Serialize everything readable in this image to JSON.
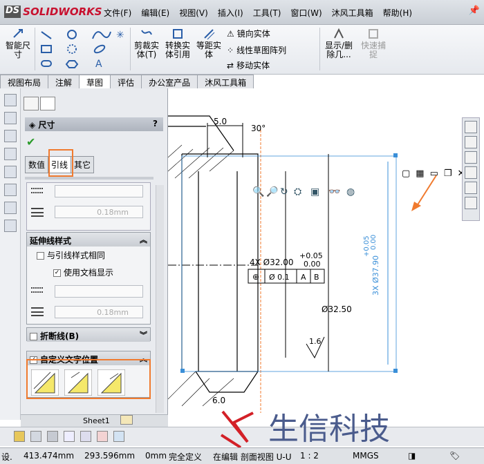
{
  "app": {
    "logo_ds": "DS",
    "logo_name": "SOLIDWORKS"
  },
  "menu": [
    "文件(F)",
    "编辑(E)",
    "视图(V)",
    "插入(I)",
    "工具(T)",
    "窗口(W)",
    "沐风工具箱",
    "帮助(H)"
  ],
  "ribbon": {
    "smart_dim": "智能尺寸",
    "trim": "剪裁实体(T)",
    "convert": "转换实体引用",
    "offset": "等距实体",
    "mirror": "镜向实体",
    "linear_pattern": "线性草图阵列",
    "move": "移动实体",
    "show_delete": "显示/删除几...",
    "quick_snap": "快速捕捉"
  },
  "tabs": [
    "视图布局",
    "注解",
    "草图",
    "评估",
    "办公室产品",
    "沐风工具箱"
  ],
  "active_tab": "草图",
  "pm": {
    "title": "尺寸",
    "help": "?",
    "check": "✔",
    "tabs": [
      "数值",
      "引线",
      "其它"
    ],
    "active_tab": "引线",
    "combo_value": "0.18mm",
    "ext_group": "延伸线样式",
    "same_as_leader": "与引线样式相同",
    "use_doc_display": "使用文档显示",
    "break_line": "折断线(B)",
    "custom_text_pos": "自定义文字位置",
    "sheet": "Sheet1"
  },
  "drawing": {
    "dim_5": "5.0",
    "angle": "30°",
    "dia32": "4X  Ø32.00",
    "tol_up": "+0.05",
    "tol_low": "0.00",
    "fcf": [
      "⊕",
      "Ø 0.1",
      "A",
      "B"
    ],
    "dia32_5": "Ø32.50",
    "rough": "1.6",
    "dim_6": "6.0",
    "rot_dim": "3X  Ø37.90",
    "rot_up": "+0.05",
    "rot_low": "0.00"
  },
  "status": {
    "x": "413.474mm",
    "y": "293.596mm",
    "z": "0mm",
    "state": "完全定义",
    "edit": "在编辑 剖面视图 U-U",
    "scale": "1 : 2",
    "units": "MMGS",
    "prefix": "设."
  },
  "watermark": "生信科技",
  "colors": {
    "accent": "#f07a2e",
    "dim_blue": "#3a8fd8",
    "red_logo": "#d32027"
  }
}
